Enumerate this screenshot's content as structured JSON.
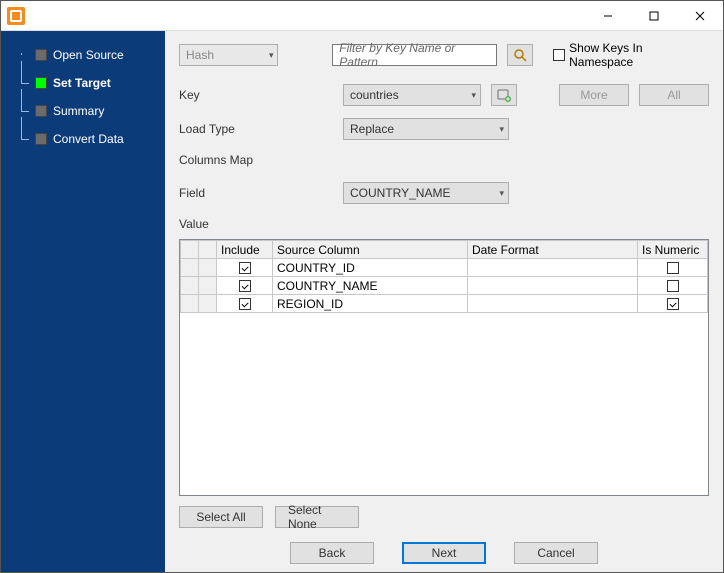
{
  "window": {
    "title": ""
  },
  "win_controls": {
    "min": "—",
    "max": "☐",
    "close": "✕"
  },
  "sidebar": {
    "items": [
      {
        "label": "Open Source",
        "active": false
      },
      {
        "label": "Set Target",
        "active": true
      },
      {
        "label": "Summary",
        "active": false
      },
      {
        "label": "Convert Data",
        "active": false
      }
    ]
  },
  "top": {
    "hash_combo": "Hash",
    "filter_placeholder": "Filter by Key Name or Pattern",
    "show_namespace_label": "Show Keys In Namespace",
    "show_namespace_checked": false
  },
  "form": {
    "key_label": "Key",
    "key_value": "countries",
    "loadtype_label": "Load Type",
    "loadtype_value": "Replace",
    "columnsmap_label": "Columns Map",
    "field_label": "Field",
    "field_value": "COUNTRY_NAME",
    "value_label": "Value",
    "more_btn": "More",
    "all_btn": "All"
  },
  "grid": {
    "headers": {
      "include": "Include",
      "source": "Source Column",
      "date": "Date Format",
      "numeric": "Is Numeric"
    },
    "rows": [
      {
        "include": true,
        "source": "COUNTRY_ID",
        "date": "",
        "numeric": false
      },
      {
        "include": true,
        "source": "COUNTRY_NAME",
        "date": "",
        "numeric": false
      },
      {
        "include": true,
        "source": "REGION_ID",
        "date": "",
        "numeric": true
      }
    ]
  },
  "footer": {
    "select_all": "Select All",
    "select_none": "Select None",
    "back": "Back",
    "next": "Next",
    "cancel": "Cancel"
  }
}
